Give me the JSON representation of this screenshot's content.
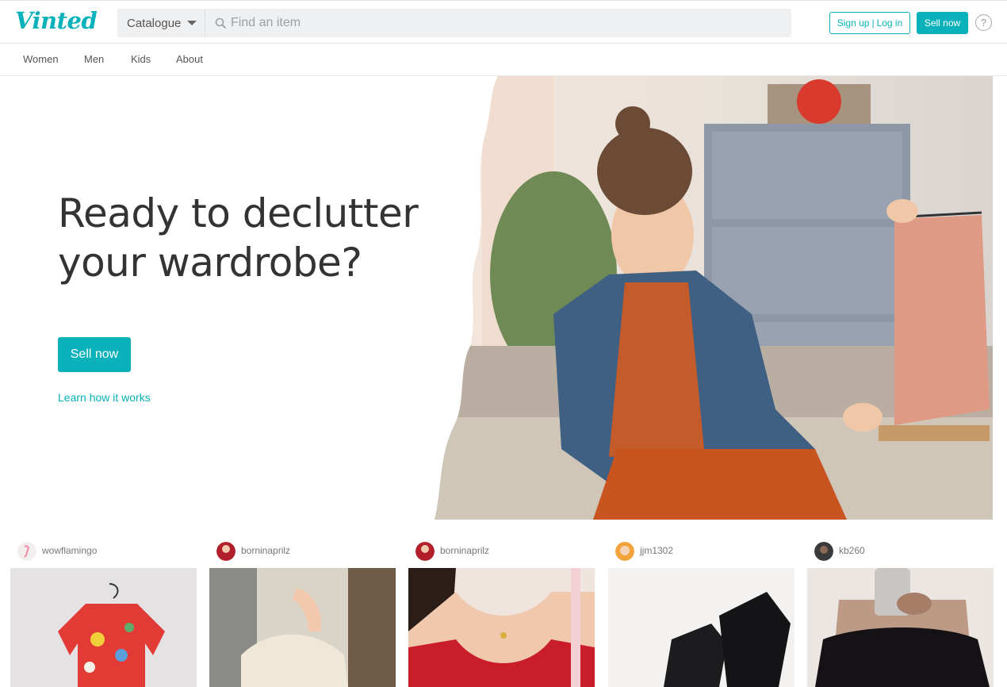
{
  "header": {
    "logo": "Vinted",
    "catalogue_label": "Catalogue",
    "search_placeholder": "Find an item",
    "signup_label": "Sign up",
    "login_label": "Log in",
    "separator": "|",
    "sell_now_label": "Sell now",
    "help_glyph": "?"
  },
  "subnav": {
    "items": [
      {
        "label": "Women"
      },
      {
        "label": "Men"
      },
      {
        "label": "Kids"
      },
      {
        "label": "About"
      }
    ]
  },
  "hero": {
    "title_line1": "Ready to declutter",
    "title_line2": "your wardrobe?",
    "cta_label": "Sell now",
    "link_label": "Learn how it works"
  },
  "feed": {
    "items": [
      {
        "username": "wowflamingo"
      },
      {
        "username": "borninaprilz"
      },
      {
        "username": "borninaprilz"
      },
      {
        "username": "jjm1302"
      },
      {
        "username": "kb260"
      }
    ]
  },
  "colors": {
    "brand": "#09b1ba",
    "text": "#333333",
    "muted": "#777777"
  },
  "icons": {
    "search": "search-icon",
    "caret": "chevron-down-icon",
    "help": "help-icon"
  }
}
